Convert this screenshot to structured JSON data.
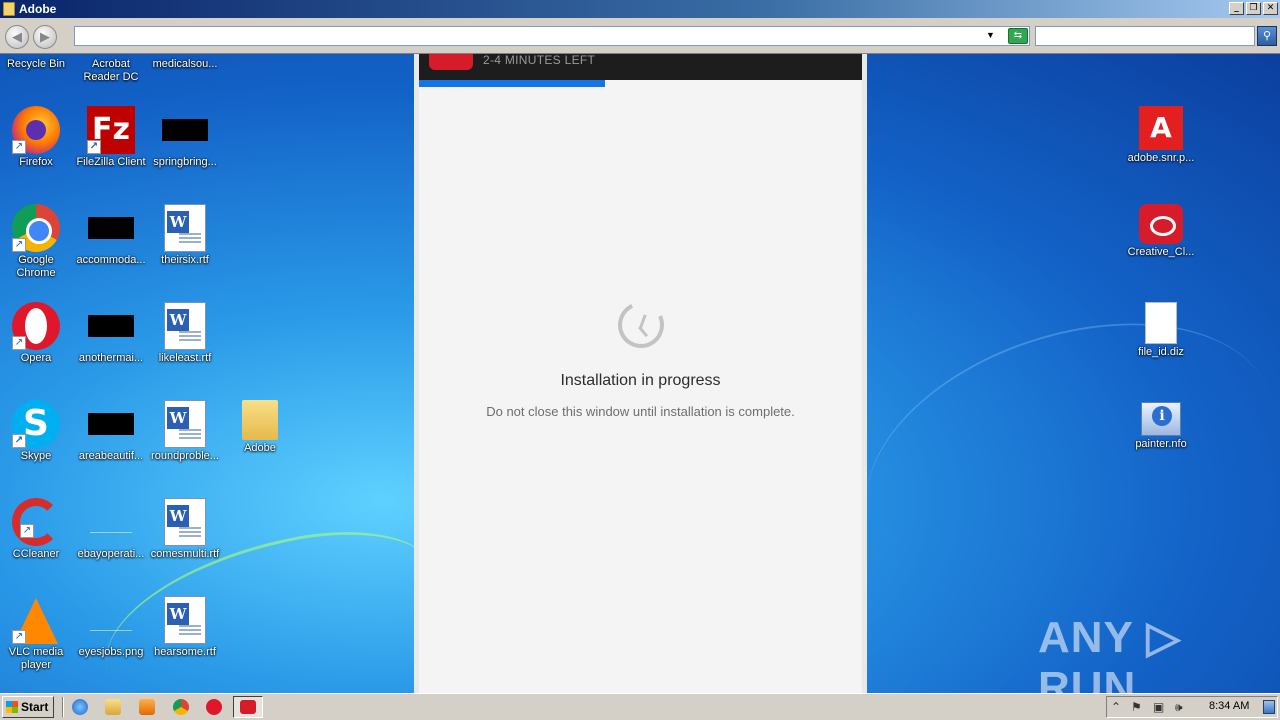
{
  "window": {
    "title": "Adobe",
    "buttons": {
      "minimize": "_",
      "restore": "❐",
      "close": "✕"
    }
  },
  "toolbar": {
    "address_value": "",
    "search_value": "",
    "back_glyph": "◀",
    "forward_glyph": "▶",
    "dropdown_glyph": "▼",
    "go_glyph": "⇆",
    "search_glyph": "⚲"
  },
  "desktop_icons": {
    "recycle_bin": "Recycle Bin",
    "acrobat": "Acrobat Reader DC",
    "medicalsou": "medicalsou...",
    "firefox": "Firefox",
    "filezilla": "FileZilla Client",
    "springbring": "springbring...",
    "chrome": "Google Chrome",
    "accommoda": "accommoda...",
    "theirsix": "theirsix.rtf",
    "opera": "Opera",
    "anothermai": "anothermai...",
    "likeleast": "likeleast.rtf",
    "skype": "Skype",
    "areabeautif": "areabeautif...",
    "roundproble": "roundproble...",
    "adobe_folder": "Adobe",
    "ccleaner": "CCleaner",
    "ebayoperati": "ebayoperati...",
    "comesmulti": "comesmulti.rtf",
    "vlc": "VLC media player",
    "eyesjobs": "eyesjobs.png",
    "hearsome": "hearsome.rtf",
    "adobe_snr": "adobe.snr.p...",
    "creative_cloud": "Creative_Cl...",
    "file_id": "file_id.diz",
    "painter": "painter.nfo"
  },
  "icon_glyphs": {
    "skype": "S",
    "filezilla": "Fz",
    "adobe": "A",
    "shortcut": "↗"
  },
  "installer": {
    "time_left": "2-4 MINUTES LEFT",
    "progress_fraction": 0.42,
    "status_title": "Installation in progress",
    "status_message": "Do not close this window until installation is complete.",
    "accent_color": "#1473e6",
    "brand_color": "#d61c2b"
  },
  "watermark": "ANY ▷ RUN",
  "taskbar": {
    "start_label": "Start",
    "clock": "8:34 AM",
    "tray_glyphs": {
      "expand": "⌃",
      "flag": "⚑",
      "network": "▣",
      "volume": "🕪"
    }
  }
}
